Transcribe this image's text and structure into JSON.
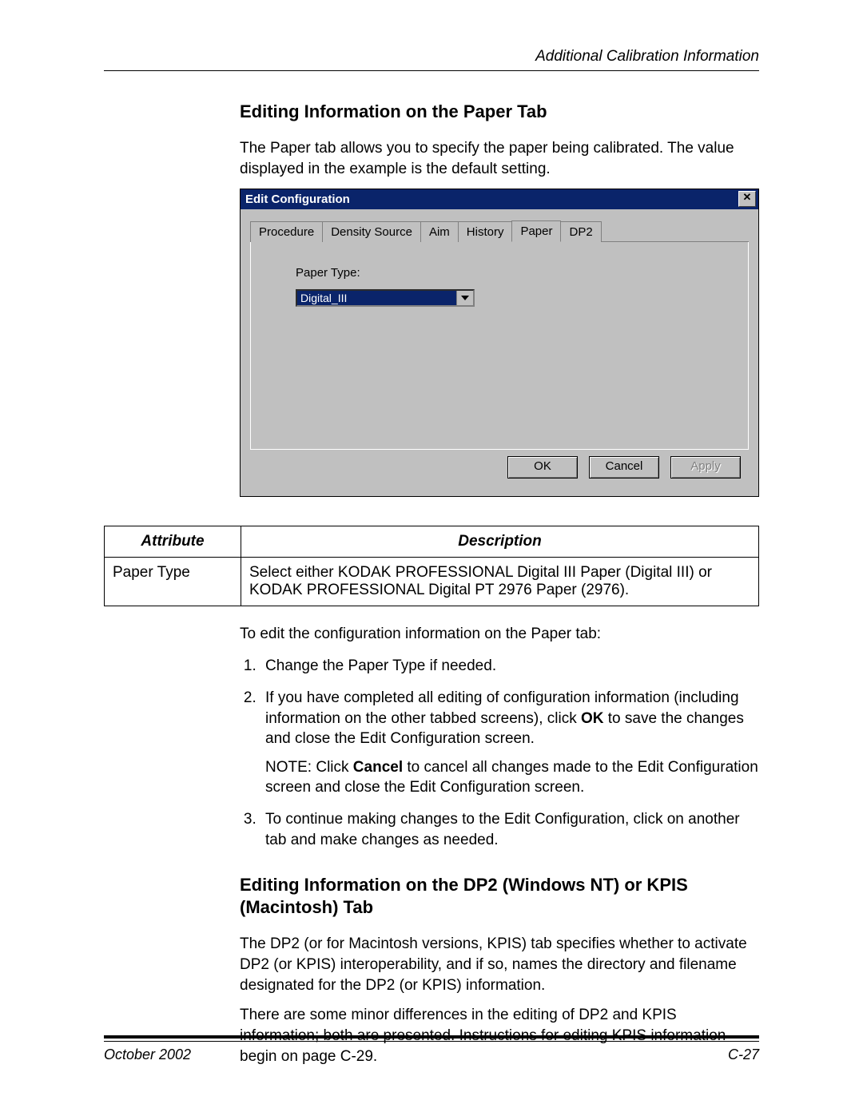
{
  "header": {
    "running": "Additional Calibration Information"
  },
  "section1": {
    "title": "Editing Information on the Paper Tab",
    "intro": "The Paper tab allows you to specify the paper being calibrated. The value displayed in the example is the default setting."
  },
  "dialog": {
    "title": "Edit Configuration",
    "close": "✕",
    "tabs": [
      "Procedure",
      "Density Source",
      "Aim",
      "History",
      "Paper",
      "DP2"
    ],
    "active_tab_index": 4,
    "paper_type_label": "Paper Type:",
    "paper_type_value": "Digital_III",
    "buttons": {
      "ok": "OK",
      "cancel": "Cancel",
      "apply": "Apply"
    }
  },
  "table": {
    "headers": [
      "Attribute",
      "Description"
    ],
    "rows": [
      {
        "attr": "Paper Type",
        "desc": "Select either KODAK PROFESSIONAL Digital III Paper (Digital III) or KODAK PROFESSIONAL Digital PT 2976 Paper (2976)."
      }
    ]
  },
  "steps": {
    "intro": "To edit the configuration information on the Paper tab:",
    "items": [
      "Change the Paper Type if needed.",
      "If you have completed all editing of configuration information (including information on the other tabbed screens), click OK to save the changes and close the Edit Configuration screen.",
      "To continue making changes to the Edit Configuration, click on another tab and make changes as needed."
    ],
    "note_label": "NOTE:",
    "note_body": " Click Cancel to cancel all changes made to the Edit Configuration screen and close the Edit Configuration screen.",
    "bold": {
      "ok": "OK",
      "cancel": "Cancel"
    }
  },
  "section2": {
    "title": "Editing Information on the DP2 (Windows NT) or KPIS (Macintosh) Tab",
    "p1": "The DP2 (or for Macintosh versions, KPIS) tab specifies whether to activate DP2 (or KPIS) interoperability, and if so, names the directory and filename designated for the DP2 (or KPIS) information.",
    "p2": "There are some minor differences in the editing of DP2 and KPIS information; both are presented. Instructions for editing KPIS information begin on page C-29."
  },
  "footer": {
    "date": "October 2002",
    "page": "C-27"
  }
}
